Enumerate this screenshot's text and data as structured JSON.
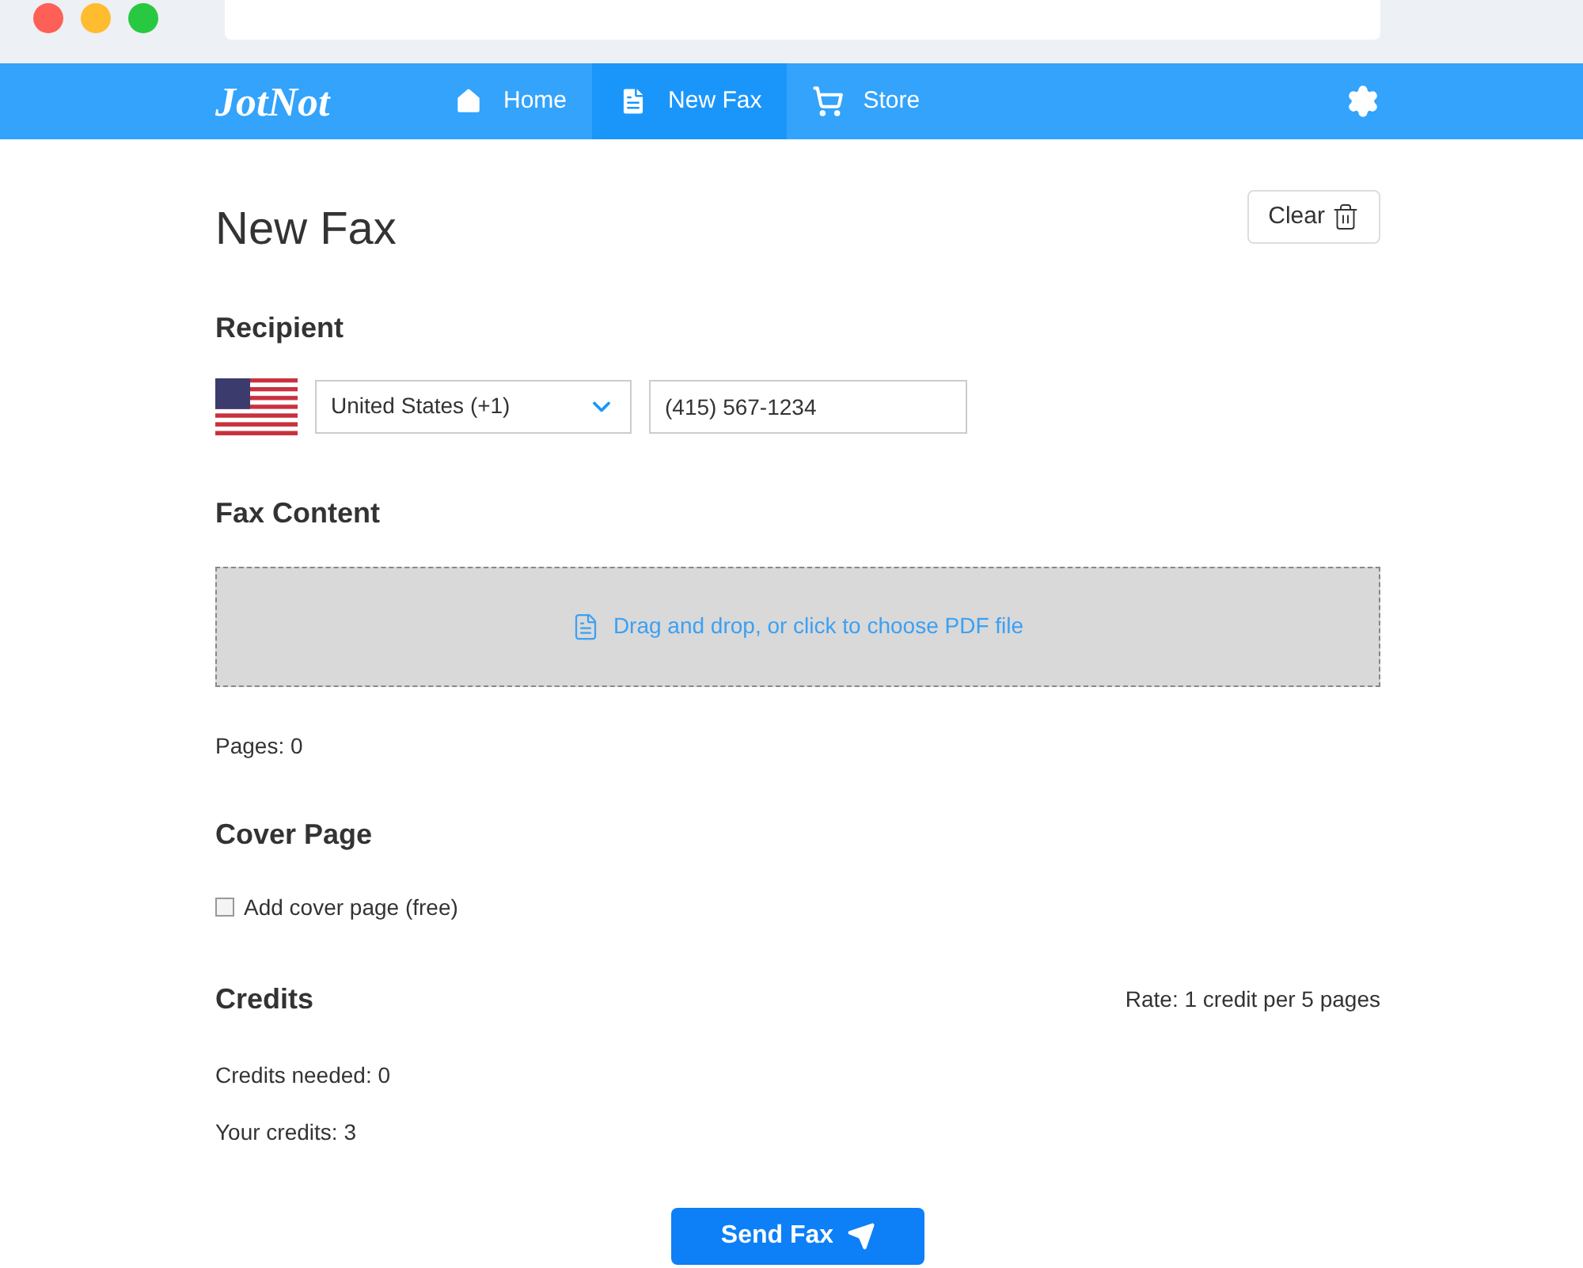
{
  "nav": {
    "logo": "JotNot",
    "tabs": [
      {
        "label": "Home",
        "kind": "home",
        "selected": false
      },
      {
        "label": "New Fax",
        "kind": "document",
        "selected": true
      },
      {
        "label": "Store",
        "kind": "cart",
        "selected": false
      }
    ]
  },
  "page": {
    "title": "New Fax",
    "clear_button": "Clear"
  },
  "recipient": {
    "heading": "Recipient",
    "country": "United States (+1)",
    "phone": "(415) 567-1234"
  },
  "fax_content": {
    "heading": "Fax Content",
    "dropzone": "Drag and drop, or click to choose PDF file",
    "pages": "Pages: 0"
  },
  "cover_page": {
    "heading": "Cover Page",
    "checkbox": {
      "label": "Add cover page (free)",
      "checked": false
    }
  },
  "credits": {
    "heading": "Credits",
    "rate": "Rate: 1 credit per 5 pages",
    "needed": "Credits needed: 0",
    "yours": "Your credits: 3"
  },
  "send_button": "Send Fax"
}
